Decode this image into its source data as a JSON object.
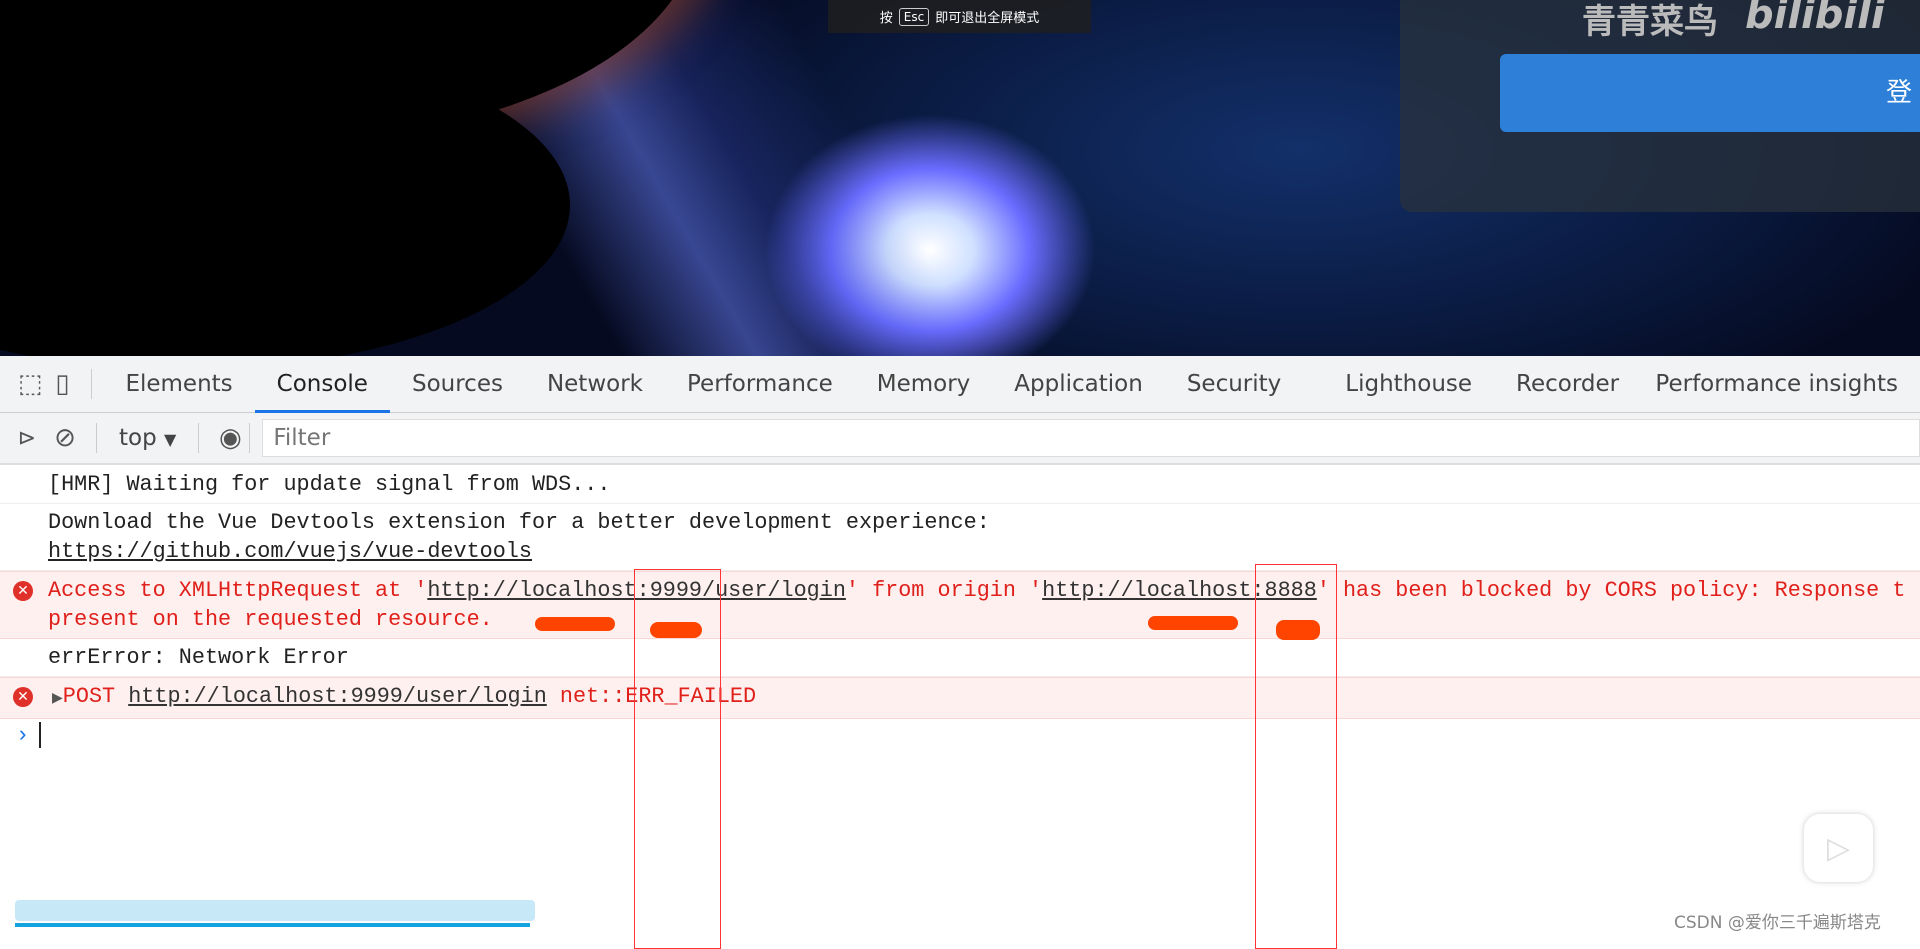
{
  "page": {
    "brand_text": "青青菜鸟",
    "brand_logo": "bilibili",
    "login_button": "登"
  },
  "fullscreen_hint": {
    "prefix": "按",
    "key": "Esc",
    "suffix": "即可退出全屏模式"
  },
  "devtools": {
    "tabs": [
      "Elements",
      "Console",
      "Sources",
      "Network",
      "Performance",
      "Memory",
      "Application",
      "Security",
      "Lighthouse",
      "Recorder",
      "Performance insights"
    ],
    "active_tab": "Console",
    "context": "top",
    "filter_placeholder": "Filter",
    "accent": "#1a73e8"
  },
  "console": {
    "hmr": "[HMR] Waiting for update signal from WDS...",
    "vue_msg": "Download the Vue Devtools extension for a better development experience:",
    "vue_link": "https://github.com/vuejs/vue-devtools",
    "cors": {
      "p1": "Access to XMLHttpRequest at '",
      "url1": "http://localhost:9999/user/login",
      "p2": "' from origin '",
      "url2": "http://localhost:8888",
      "p3": "' has been blocked by CORS policy: Response t",
      "line2": "present on the requested resource."
    },
    "net_error": "errError: Network Error",
    "post": {
      "method": "POST",
      "url": "http://localhost:9999/user/login",
      "err": "net::ERR_FAILED"
    },
    "error_color": "#e0201a"
  },
  "watermark": "CSDN @爱你三千遍斯塔克"
}
